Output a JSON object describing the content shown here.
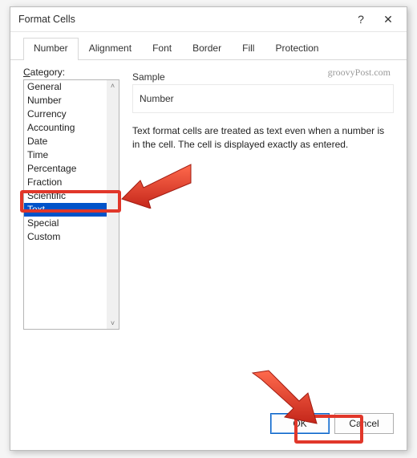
{
  "dialog": {
    "title": "Format Cells",
    "help_symbol": "?",
    "close_symbol": "✕"
  },
  "tabs": {
    "number": "Number",
    "alignment": "Alignment",
    "font": "Font",
    "border": "Border",
    "fill": "Fill",
    "protection": "Protection"
  },
  "category": {
    "label_underline": "C",
    "label_rest": "ategory:",
    "items": {
      "general": "General",
      "number": "Number",
      "currency": "Currency",
      "accounting": "Accounting",
      "date": "Date",
      "time": "Time",
      "percentage": "Percentage",
      "fraction": "Fraction",
      "scientific": "Scientific",
      "text": "Text",
      "special": "Special",
      "custom": "Custom"
    },
    "selected": "text"
  },
  "sample": {
    "label": "Sample",
    "value": "Number"
  },
  "description": "Text format cells are treated as text even when a number is in the cell. The cell is displayed exactly as entered.",
  "watermark": "groovyPost.com",
  "buttons": {
    "ok": "OK",
    "cancel": "Cancel"
  },
  "scroll": {
    "up": "˄",
    "down": "˅"
  }
}
